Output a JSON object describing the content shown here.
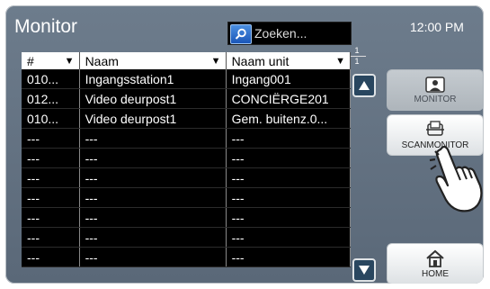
{
  "header": {
    "title": "Monitor",
    "clock": "12:00 PM"
  },
  "search": {
    "placeholder": "Zoeken..."
  },
  "pager": {
    "current": "1",
    "total": "1"
  },
  "table": {
    "columns": [
      "#",
      "Naam",
      "Naam unit"
    ],
    "rows": [
      [
        "010...",
        "Ingangsstation1",
        "Ingang001"
      ],
      [
        "012...",
        "Video deurpost1",
        "CONCIËRGE201"
      ],
      [
        "010...",
        "Video deurpost1",
        "Gem. buitenz.0..."
      ],
      [
        "---",
        "---",
        "---"
      ],
      [
        "---",
        "---",
        "---"
      ],
      [
        "---",
        "---",
        "---"
      ],
      [
        "---",
        "---",
        "---"
      ],
      [
        "---",
        "---",
        "---"
      ],
      [
        "---",
        "---",
        "---"
      ],
      [
        "---",
        "---",
        "---"
      ]
    ]
  },
  "buttons": {
    "monitor": "MONITOR",
    "scan_monitor": "SCANMONITOR",
    "home": "HOME"
  },
  "icons": {
    "search": "search-icon",
    "scroll_up": "arrow-up-icon",
    "scroll_down": "arrow-down-icon",
    "pointer": "hand-pointer-icon"
  }
}
